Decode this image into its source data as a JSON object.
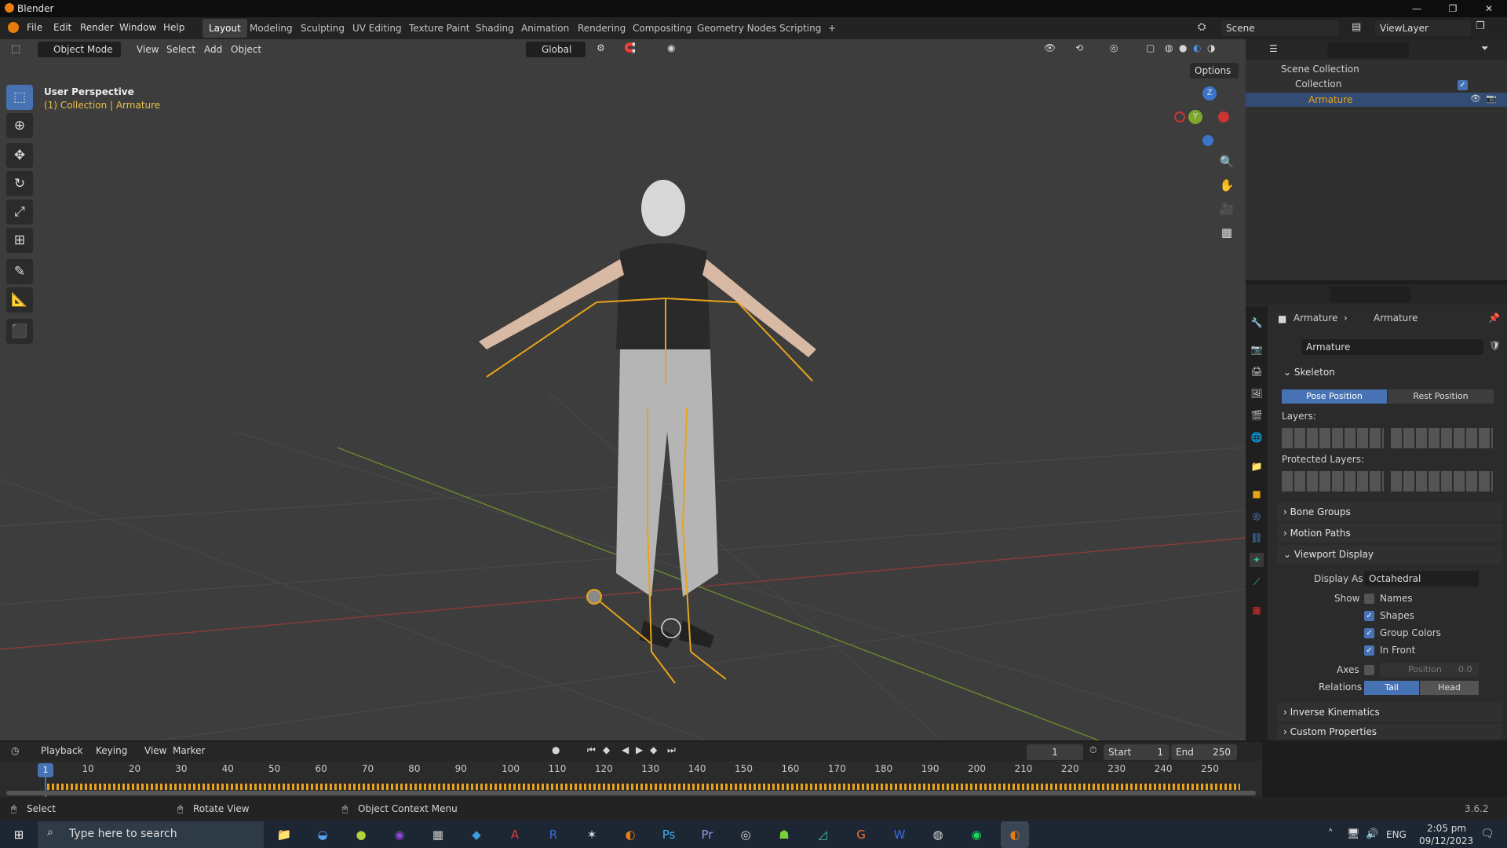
{
  "window": {
    "title": "Blender",
    "controls": [
      "—",
      "❐",
      "✕"
    ]
  },
  "menus": [
    "File",
    "Edit",
    "Render",
    "Window",
    "Help"
  ],
  "workspaces": [
    "Layout",
    "Modeling",
    "Sculpting",
    "UV Editing",
    "Texture Paint",
    "Shading",
    "Animation",
    "Rendering",
    "Compositing",
    "Geometry Nodes",
    "Scripting"
  ],
  "add_tab": "+",
  "scene": {
    "name": "Scene",
    "view_layer": "ViewLayer"
  },
  "viewport": {
    "mode": "Object Mode",
    "menu": [
      "View",
      "Select",
      "Add",
      "Object"
    ],
    "transform_orientation": "Global",
    "options_label": "Options",
    "overlay_title": "User Perspective",
    "overlay_subtitle": "(1) Collection | Armature",
    "gizmo": {
      "z": "Z",
      "y": "Y"
    }
  },
  "tools": [
    "select-box",
    "cursor",
    "move",
    "rotate",
    "scale",
    "transform",
    "annotate",
    "measure",
    "add-cube"
  ],
  "outliner": {
    "root": "Scene Collection",
    "items": [
      {
        "label": "Collection"
      },
      {
        "label": "Armature"
      }
    ]
  },
  "properties": {
    "breadcrumb": [
      "Armature",
      "Armature"
    ],
    "datablock": "Armature",
    "skeleton": {
      "header": "Skeleton",
      "pose_btn": "Pose Position",
      "rest_btn": "Rest Position",
      "layers_label": "Layers:",
      "protected_label": "Protected Layers:"
    },
    "bone_groups": "Bone Groups",
    "motion_paths": "Motion Paths",
    "viewport_display": {
      "header": "Viewport Display",
      "display_as_label": "Display As",
      "display_as_value": "Octahedral",
      "show_label": "Show",
      "names": "Names",
      "shapes": "Shapes",
      "group_colors": "Group Colors",
      "in_front": "In Front",
      "axes_label": "Axes",
      "position_label": "Position",
      "position_value": "0.0",
      "relations_label": "Relations",
      "tail": "Tail",
      "head": "Head"
    },
    "inverse_kinematics": "Inverse Kinematics",
    "custom_properties": "Custom Properties"
  },
  "timeline": {
    "menu": [
      "Playback",
      "Keying",
      "View",
      "Marker"
    ],
    "current_frame": "1",
    "start_label": "Start",
    "start": "1",
    "end_label": "End",
    "end": "250",
    "ticks": [
      "1",
      "10",
      "20",
      "30",
      "40",
      "50",
      "60",
      "70",
      "80",
      "90",
      "100",
      "110",
      "120",
      "130",
      "140",
      "150",
      "160",
      "170",
      "180",
      "190",
      "200",
      "210",
      "220",
      "230",
      "240",
      "250"
    ]
  },
  "statusbar": {
    "select": "Select",
    "rotate": "Rotate View",
    "context": "Object Context Menu",
    "version": "3.6.2"
  },
  "taskbar": {
    "search_placeholder": "Type here to search",
    "lang": "ENG",
    "time": "2:05 pm",
    "date": "09/12/2023",
    "apps": [
      "File Explorer",
      "Google Earth",
      "Tennis",
      "Purple app",
      "Calculator",
      "Store",
      "AutoCAD",
      "Revit",
      "Rhino",
      "Blender",
      "Photoshop",
      "Premiere",
      "OBS",
      "Android",
      "SketchUp",
      "Grammarly",
      "Word",
      "Globe",
      "Spotify",
      "Blender active"
    ]
  },
  "colors": {
    "accent": "#4772b3",
    "orange": "#e8a31a",
    "bg": "#3d3d3d"
  }
}
